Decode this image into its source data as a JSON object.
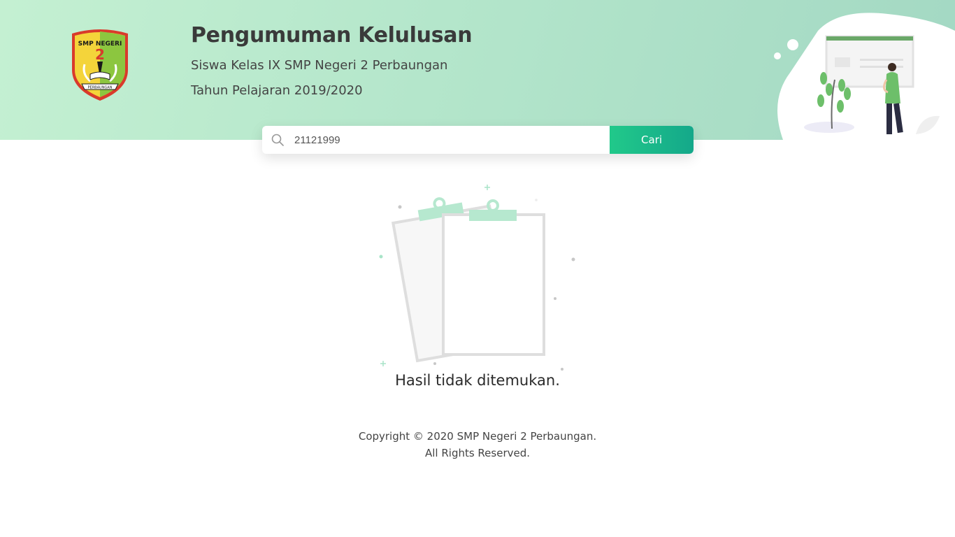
{
  "header": {
    "title": "Pengumuman Kelulusan",
    "subtitle": "Siswa Kelas IX SMP Negeri 2 Perbaungan",
    "year": "Tahun Pelajaran 2019/2020",
    "logo": {
      "top_text": "SMP NEGERI",
      "number": "2",
      "banner_text": "PERBAUNGAN"
    }
  },
  "search": {
    "value": "21121999",
    "button_label": "Cari",
    "icon": "search-icon"
  },
  "result": {
    "message": "Hasil tidak ditemukan."
  },
  "footer": {
    "copyright": "Copyright © 2020 SMP Negeri 2 Perbaungan.",
    "rights": "All Rights Reserved."
  },
  "colors": {
    "accent": "#1fbf8a",
    "hero_start": "#c4f0d2",
    "hero_end": "#a3d8c3",
    "text_dark": "#3a3a3a"
  }
}
